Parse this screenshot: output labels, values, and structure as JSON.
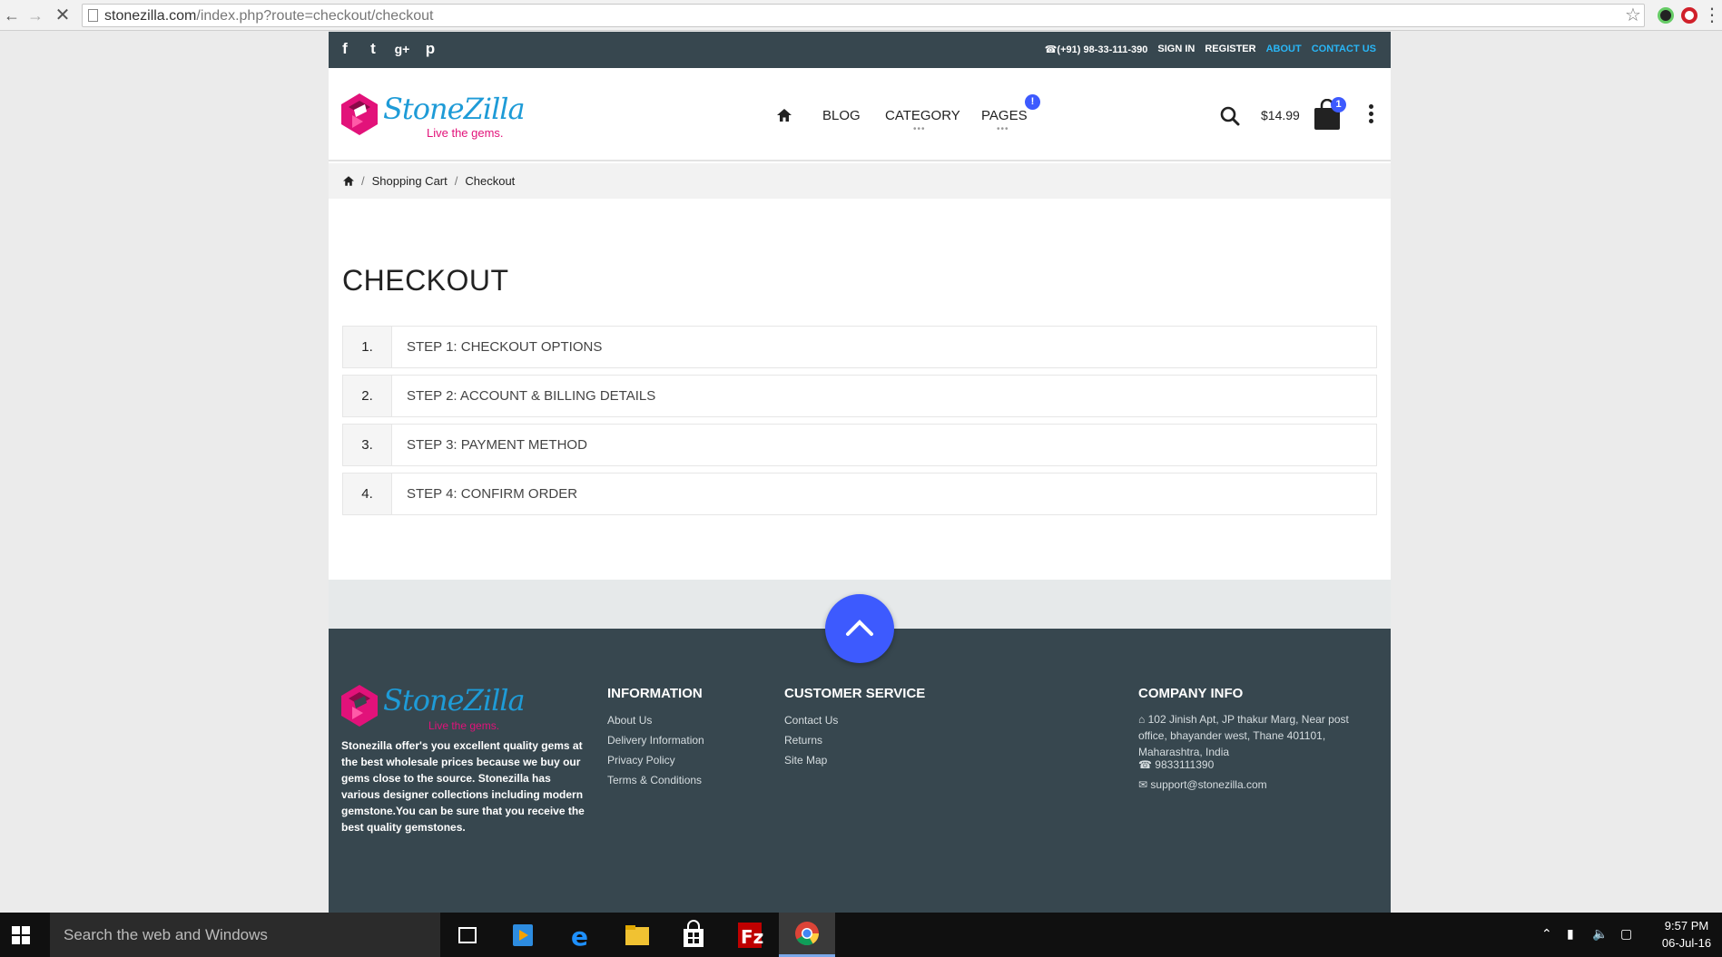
{
  "browser": {
    "url_domain": "stonezilla.com",
    "url_path": "/index.php?route=checkout/checkout"
  },
  "topbar": {
    "phone": "(+91) 98-33-111-390",
    "sign_in": "SIGN IN",
    "register": "REGISTER",
    "about": "ABOUT",
    "contact_us": "CONTACT US",
    "social_icons": [
      "facebook-icon",
      "twitter-icon",
      "google-plus-icon",
      "pinterest-icon"
    ]
  },
  "header": {
    "logo_text": "StoneZilla",
    "logo_tagline": "Live the gems.",
    "nav": {
      "blog": "BLOG",
      "category": "CATEGORY",
      "pages": "PAGES"
    },
    "pages_badge": "!",
    "cart_total": "$14.99",
    "cart_count": "1"
  },
  "breadcrumb": [
    "Shopping Cart",
    "Checkout"
  ],
  "page": {
    "title": "CHECKOUT",
    "steps": [
      {
        "num": "1.",
        "label": "STEP 1: CHECKOUT OPTIONS"
      },
      {
        "num": "2.",
        "label": "STEP 2: ACCOUNT & BILLING DETAILS"
      },
      {
        "num": "3.",
        "label": "STEP 3: PAYMENT METHOD"
      },
      {
        "num": "4.",
        "label": "STEP 4: CONFIRM ORDER"
      }
    ]
  },
  "footer": {
    "logo_text": "StoneZilla",
    "logo_tagline": "Live the gems.",
    "about": "Stonezilla offer's you excellent quality gems at the best wholesale prices because we buy our gems close to the source. Stonezilla has various designer collections including modern gemstone.You can be sure that you receive the best quality gemstones.",
    "information": {
      "heading": "INFORMATION",
      "links": [
        "About Us",
        "Delivery Information",
        "Privacy Policy",
        "Terms & Conditions"
      ]
    },
    "customer_service": {
      "heading": "CUSTOMER SERVICE",
      "links": [
        "Contact Us",
        "Returns",
        "Site Map"
      ]
    },
    "company_info": {
      "heading": "COMPANY INFO",
      "address": "102 Jinish Apt, JP thakur Marg, Near post office, bhayander west, Thane 401101, Maharashtra, India",
      "phone": "9833111390",
      "email": "support@stonezilla.com"
    }
  },
  "taskbar": {
    "search_placeholder": "Search the web and Windows",
    "time": "9:57 PM",
    "date": "06-Jul-16"
  },
  "colors": {
    "accent_blue": "#3d5afe",
    "dark_slate": "#37474f",
    "brand_blue": "#1e9bd7",
    "brand_pink": "#e2127a",
    "link_cyan": "#29b6f6"
  }
}
